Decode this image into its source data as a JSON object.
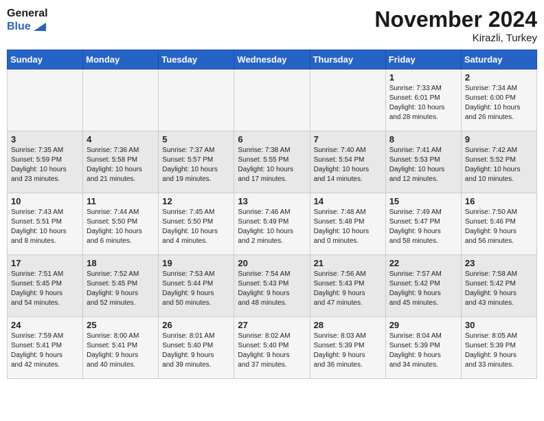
{
  "header": {
    "logo_line1": "General",
    "logo_line2": "Blue",
    "month": "November 2024",
    "location": "Kirazli, Turkey"
  },
  "weekdays": [
    "Sunday",
    "Monday",
    "Tuesday",
    "Wednesday",
    "Thursday",
    "Friday",
    "Saturday"
  ],
  "weeks": [
    [
      {
        "day": "",
        "info": ""
      },
      {
        "day": "",
        "info": ""
      },
      {
        "day": "",
        "info": ""
      },
      {
        "day": "",
        "info": ""
      },
      {
        "day": "",
        "info": ""
      },
      {
        "day": "1",
        "info": "Sunrise: 7:33 AM\nSunset: 6:01 PM\nDaylight: 10 hours\nand 28 minutes."
      },
      {
        "day": "2",
        "info": "Sunrise: 7:34 AM\nSunset: 6:00 PM\nDaylight: 10 hours\nand 26 minutes."
      }
    ],
    [
      {
        "day": "3",
        "info": "Sunrise: 7:35 AM\nSunset: 5:59 PM\nDaylight: 10 hours\nand 23 minutes."
      },
      {
        "day": "4",
        "info": "Sunrise: 7:36 AM\nSunset: 5:58 PM\nDaylight: 10 hours\nand 21 minutes."
      },
      {
        "day": "5",
        "info": "Sunrise: 7:37 AM\nSunset: 5:57 PM\nDaylight: 10 hours\nand 19 minutes."
      },
      {
        "day": "6",
        "info": "Sunrise: 7:38 AM\nSunset: 5:55 PM\nDaylight: 10 hours\nand 17 minutes."
      },
      {
        "day": "7",
        "info": "Sunrise: 7:40 AM\nSunset: 5:54 PM\nDaylight: 10 hours\nand 14 minutes."
      },
      {
        "day": "8",
        "info": "Sunrise: 7:41 AM\nSunset: 5:53 PM\nDaylight: 10 hours\nand 12 minutes."
      },
      {
        "day": "9",
        "info": "Sunrise: 7:42 AM\nSunset: 5:52 PM\nDaylight: 10 hours\nand 10 minutes."
      }
    ],
    [
      {
        "day": "10",
        "info": "Sunrise: 7:43 AM\nSunset: 5:51 PM\nDaylight: 10 hours\nand 8 minutes."
      },
      {
        "day": "11",
        "info": "Sunrise: 7:44 AM\nSunset: 5:50 PM\nDaylight: 10 hours\nand 6 minutes."
      },
      {
        "day": "12",
        "info": "Sunrise: 7:45 AM\nSunset: 5:50 PM\nDaylight: 10 hours\nand 4 minutes."
      },
      {
        "day": "13",
        "info": "Sunrise: 7:46 AM\nSunset: 5:49 PM\nDaylight: 10 hours\nand 2 minutes."
      },
      {
        "day": "14",
        "info": "Sunrise: 7:48 AM\nSunset: 5:48 PM\nDaylight: 10 hours\nand 0 minutes."
      },
      {
        "day": "15",
        "info": "Sunrise: 7:49 AM\nSunset: 5:47 PM\nDaylight: 9 hours\nand 58 minutes."
      },
      {
        "day": "16",
        "info": "Sunrise: 7:50 AM\nSunset: 5:46 PM\nDaylight: 9 hours\nand 56 minutes."
      }
    ],
    [
      {
        "day": "17",
        "info": "Sunrise: 7:51 AM\nSunset: 5:45 PM\nDaylight: 9 hours\nand 54 minutes."
      },
      {
        "day": "18",
        "info": "Sunrise: 7:52 AM\nSunset: 5:45 PM\nDaylight: 9 hours\nand 52 minutes."
      },
      {
        "day": "19",
        "info": "Sunrise: 7:53 AM\nSunset: 5:44 PM\nDaylight: 9 hours\nand 50 minutes."
      },
      {
        "day": "20",
        "info": "Sunrise: 7:54 AM\nSunset: 5:43 PM\nDaylight: 9 hours\nand 48 minutes."
      },
      {
        "day": "21",
        "info": "Sunrise: 7:56 AM\nSunset: 5:43 PM\nDaylight: 9 hours\nand 47 minutes."
      },
      {
        "day": "22",
        "info": "Sunrise: 7:57 AM\nSunset: 5:42 PM\nDaylight: 9 hours\nand 45 minutes."
      },
      {
        "day": "23",
        "info": "Sunrise: 7:58 AM\nSunset: 5:42 PM\nDaylight: 9 hours\nand 43 minutes."
      }
    ],
    [
      {
        "day": "24",
        "info": "Sunrise: 7:59 AM\nSunset: 5:41 PM\nDaylight: 9 hours\nand 42 minutes."
      },
      {
        "day": "25",
        "info": "Sunrise: 8:00 AM\nSunset: 5:41 PM\nDaylight: 9 hours\nand 40 minutes."
      },
      {
        "day": "26",
        "info": "Sunrise: 8:01 AM\nSunset: 5:40 PM\nDaylight: 9 hours\nand 39 minutes."
      },
      {
        "day": "27",
        "info": "Sunrise: 8:02 AM\nSunset: 5:40 PM\nDaylight: 9 hours\nand 37 minutes."
      },
      {
        "day": "28",
        "info": "Sunrise: 8:03 AM\nSunset: 5:39 PM\nDaylight: 9 hours\nand 36 minutes."
      },
      {
        "day": "29",
        "info": "Sunrise: 8:04 AM\nSunset: 5:39 PM\nDaylight: 9 hours\nand 34 minutes."
      },
      {
        "day": "30",
        "info": "Sunrise: 8:05 AM\nSunset: 5:39 PM\nDaylight: 9 hours\nand 33 minutes."
      }
    ]
  ]
}
